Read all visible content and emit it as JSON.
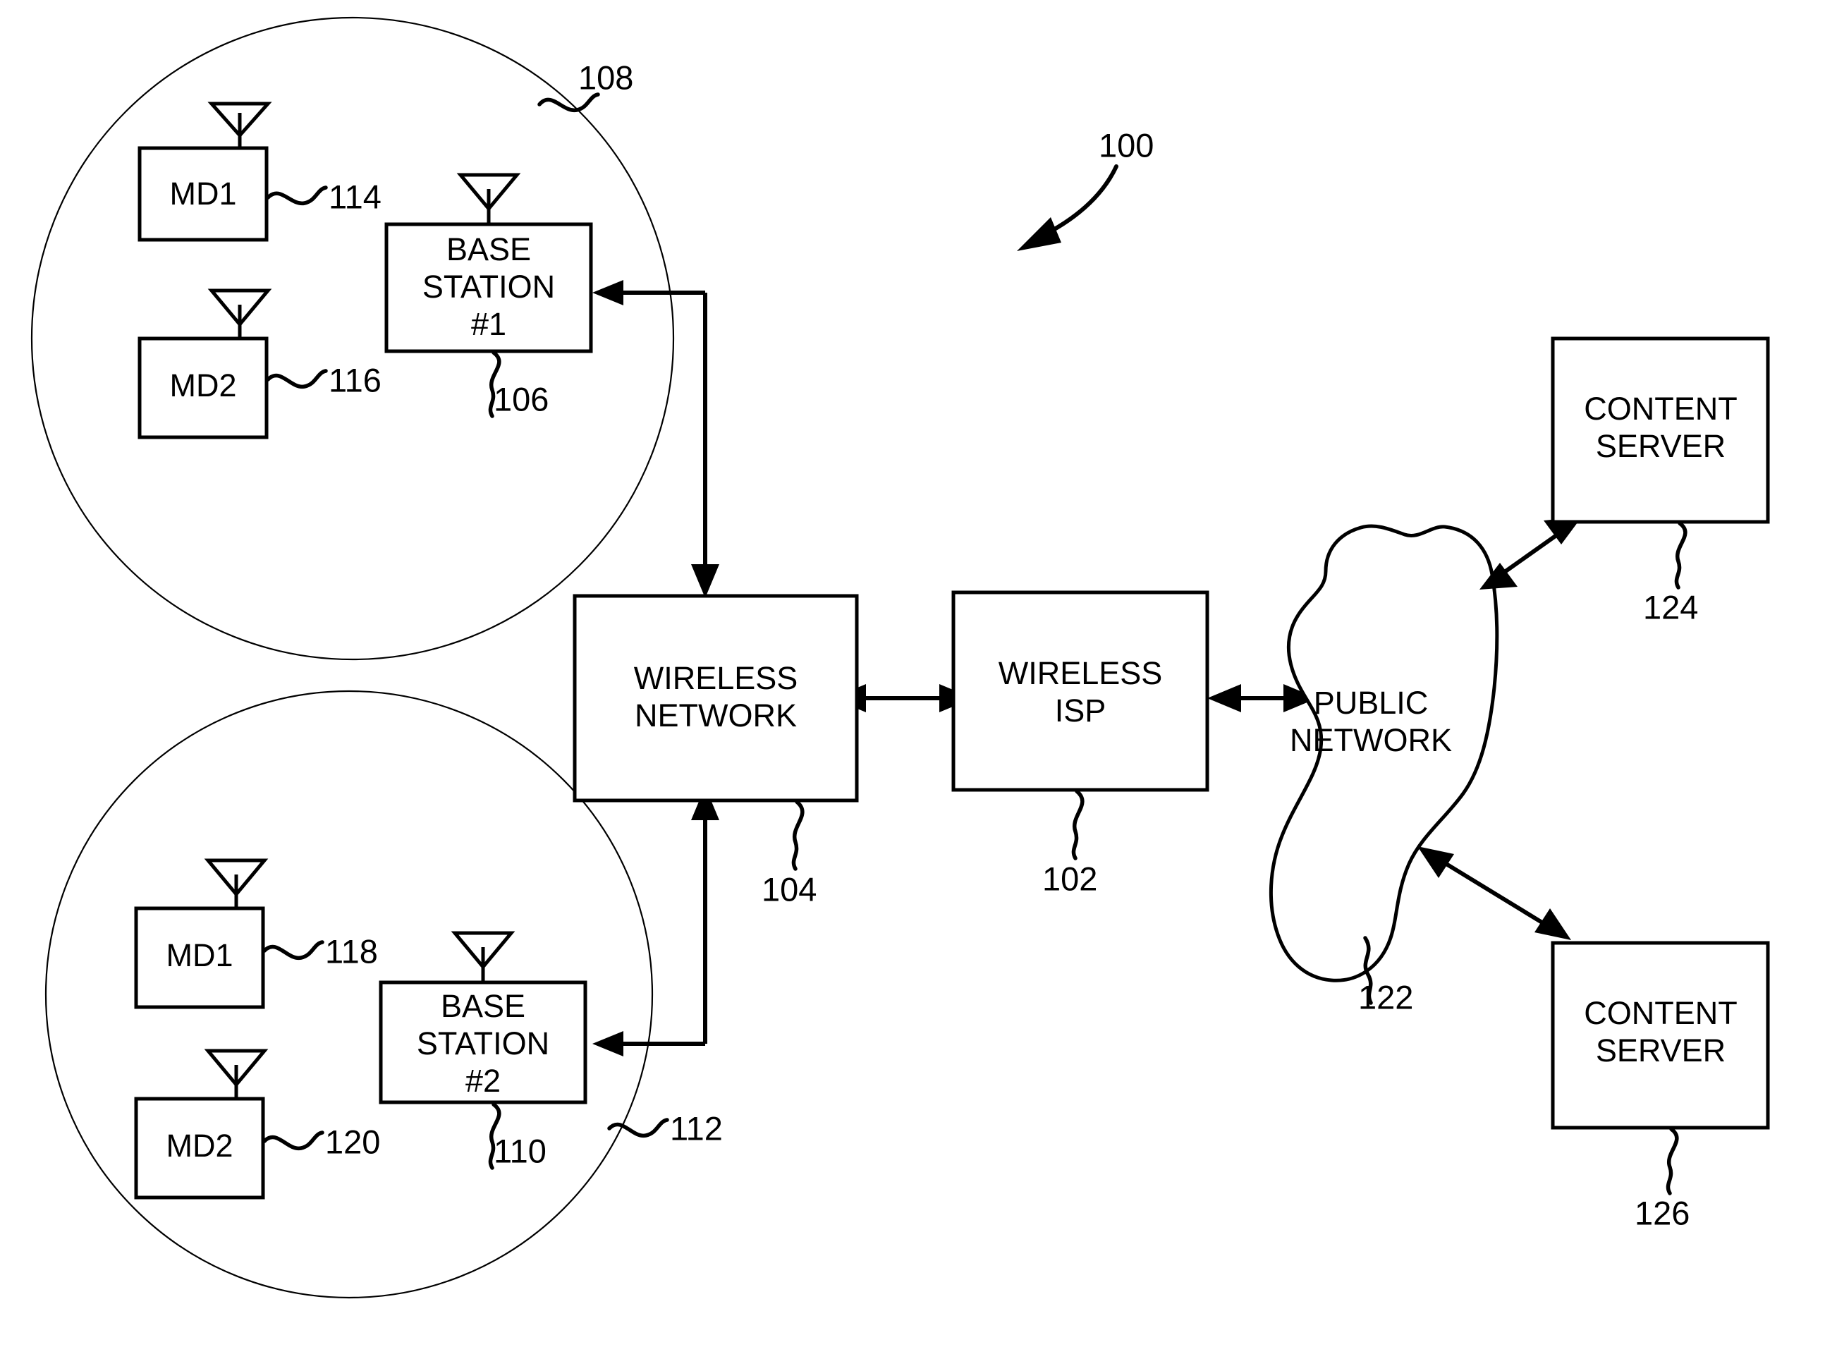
{
  "figure": {
    "figure_ref": "100",
    "cells": [
      {
        "id": "cell-1",
        "ref": "108",
        "base_station": {
          "line1": "BASE",
          "line2": "STATION",
          "line3": "#1",
          "ref": "106"
        },
        "devices": [
          {
            "label": "MD1",
            "ref": "114"
          },
          {
            "label": "MD2",
            "ref": "116"
          }
        ]
      },
      {
        "id": "cell-2",
        "ref": "112",
        "base_station": {
          "line1": "BASE",
          "line2": "STATION",
          "line3": "#2",
          "ref": "110"
        },
        "devices": [
          {
            "label": "MD1",
            "ref": "118"
          },
          {
            "label": "MD2",
            "ref": "120"
          }
        ]
      }
    ],
    "wireless_network": {
      "line1": "WIRELESS",
      "line2": "NETWORK",
      "ref": "104"
    },
    "wireless_isp": {
      "line1": "WIRELESS",
      "line2": "ISP",
      "ref": "102"
    },
    "public_network": {
      "line1": "PUBLIC",
      "line2": "NETWORK",
      "ref": "122"
    },
    "content_servers": [
      {
        "line1": "CONTENT",
        "line2": "SERVER",
        "ref": "124"
      },
      {
        "line1": "CONTENT",
        "line2": "SERVER",
        "ref": "126"
      }
    ],
    "colors": {
      "stroke": "#000000",
      "background": "#ffffff"
    }
  }
}
